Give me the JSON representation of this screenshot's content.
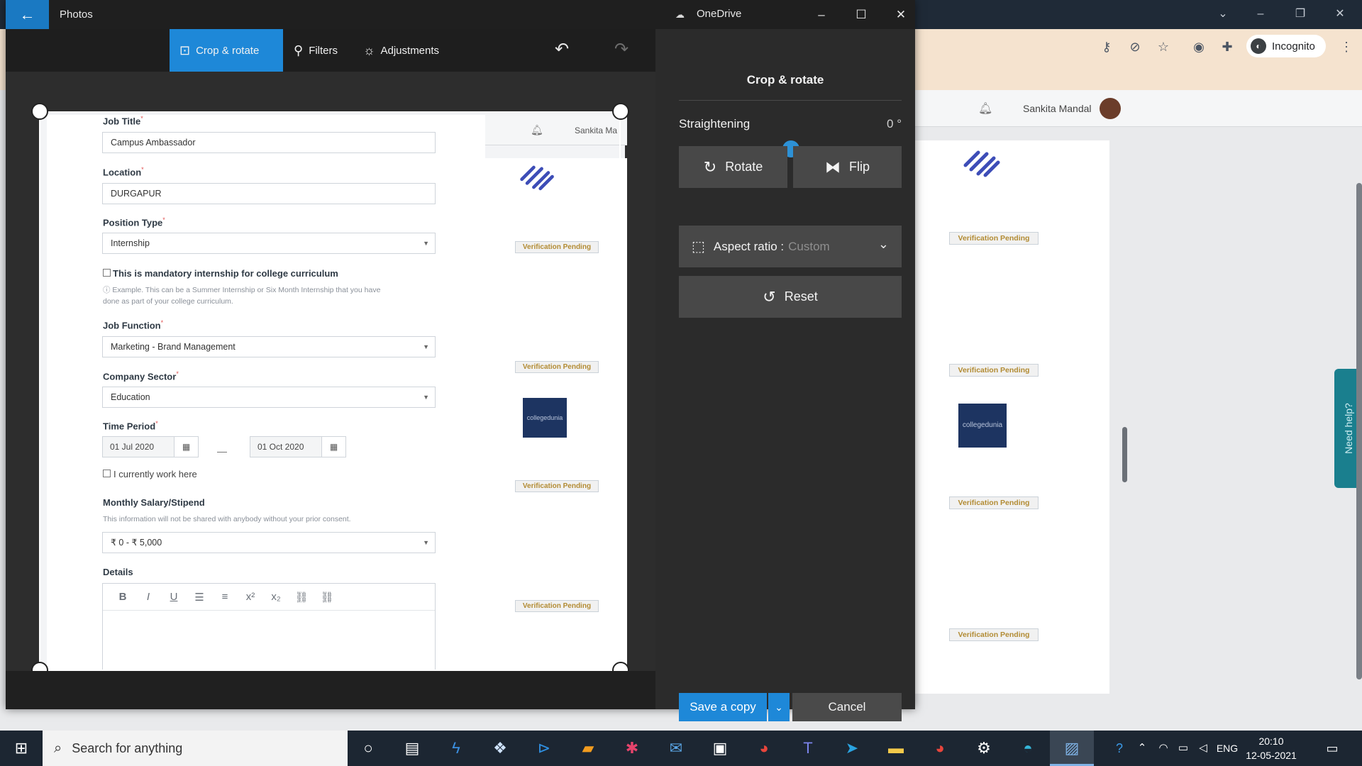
{
  "browser": {
    "incognito_label": "Incognito",
    "profile_name": "Sankita Mandal",
    "badges": [
      "Verification Pending",
      "Verification Pending",
      "Verification Pending",
      "Verification Pending"
    ],
    "cd_logo": "collegedunia",
    "need_help": "Need help?"
  },
  "window": {
    "app_title": "Photos",
    "onedrive_label": "OneDrive"
  },
  "toolbar": {
    "crop_rotate": "Crop & rotate",
    "filters": "Filters",
    "adjustments": "Adjustments"
  },
  "image": {
    "header_name": "Sankita Ma",
    "fields": {
      "job_title_label": "Job Title",
      "job_title_value": "Campus Ambassador",
      "location_label": "Location",
      "location_value": "DURGAPUR",
      "position_type_label": "Position Type",
      "position_type_value": "Internship",
      "mandatory_label": "This is mandatory internship for college curriculum",
      "mandatory_help_1": "ⓘ Example. This can be a Summer Internship or Six Month Internship that you have",
      "mandatory_help_2": "done as part of your college curriculum.",
      "job_function_label": "Job Function",
      "job_function_value": "Marketing - Brand Management",
      "company_sector_label": "Company Sector",
      "company_sector_value": "Education",
      "time_period_label": "Time Period",
      "start_date": "01 Jul 2020",
      "end_date": "01 Oct 2020",
      "current_work_label": "I currently work here",
      "salary_label": "Monthly Salary/Stipend",
      "salary_help": "This information will not be shared with anybody without your prior consent.",
      "salary_value": "₹ 0 - ₹ 5,000",
      "details_label": "Details"
    },
    "badges": [
      "Verification Pending",
      "Verification Pending",
      "Verification Pending",
      "Verification Pending"
    ],
    "cd_logo": "collegedunia"
  },
  "panel": {
    "title": "Crop & rotate",
    "straightening_label": "Straightening",
    "straightening_value": "0 °",
    "straightening_fraction": 0.5,
    "rotate_label": "Rotate",
    "flip_label": "Flip",
    "aspect_label": "Aspect ratio :",
    "aspect_value": "Custom",
    "reset_label": "Reset",
    "save_label": "Save a copy",
    "cancel_label": "Cancel"
  },
  "taskbar": {
    "search_placeholder": "Search for anything",
    "language": "ENG",
    "time": "20:10",
    "date": "12-05-2021"
  },
  "colors": {
    "accent": "#1e88d8",
    "panel_bg": "#2b2b2b",
    "button_bg": "#484848",
    "badge_text": "#b28b33",
    "brand_navy": "#1d3461"
  }
}
